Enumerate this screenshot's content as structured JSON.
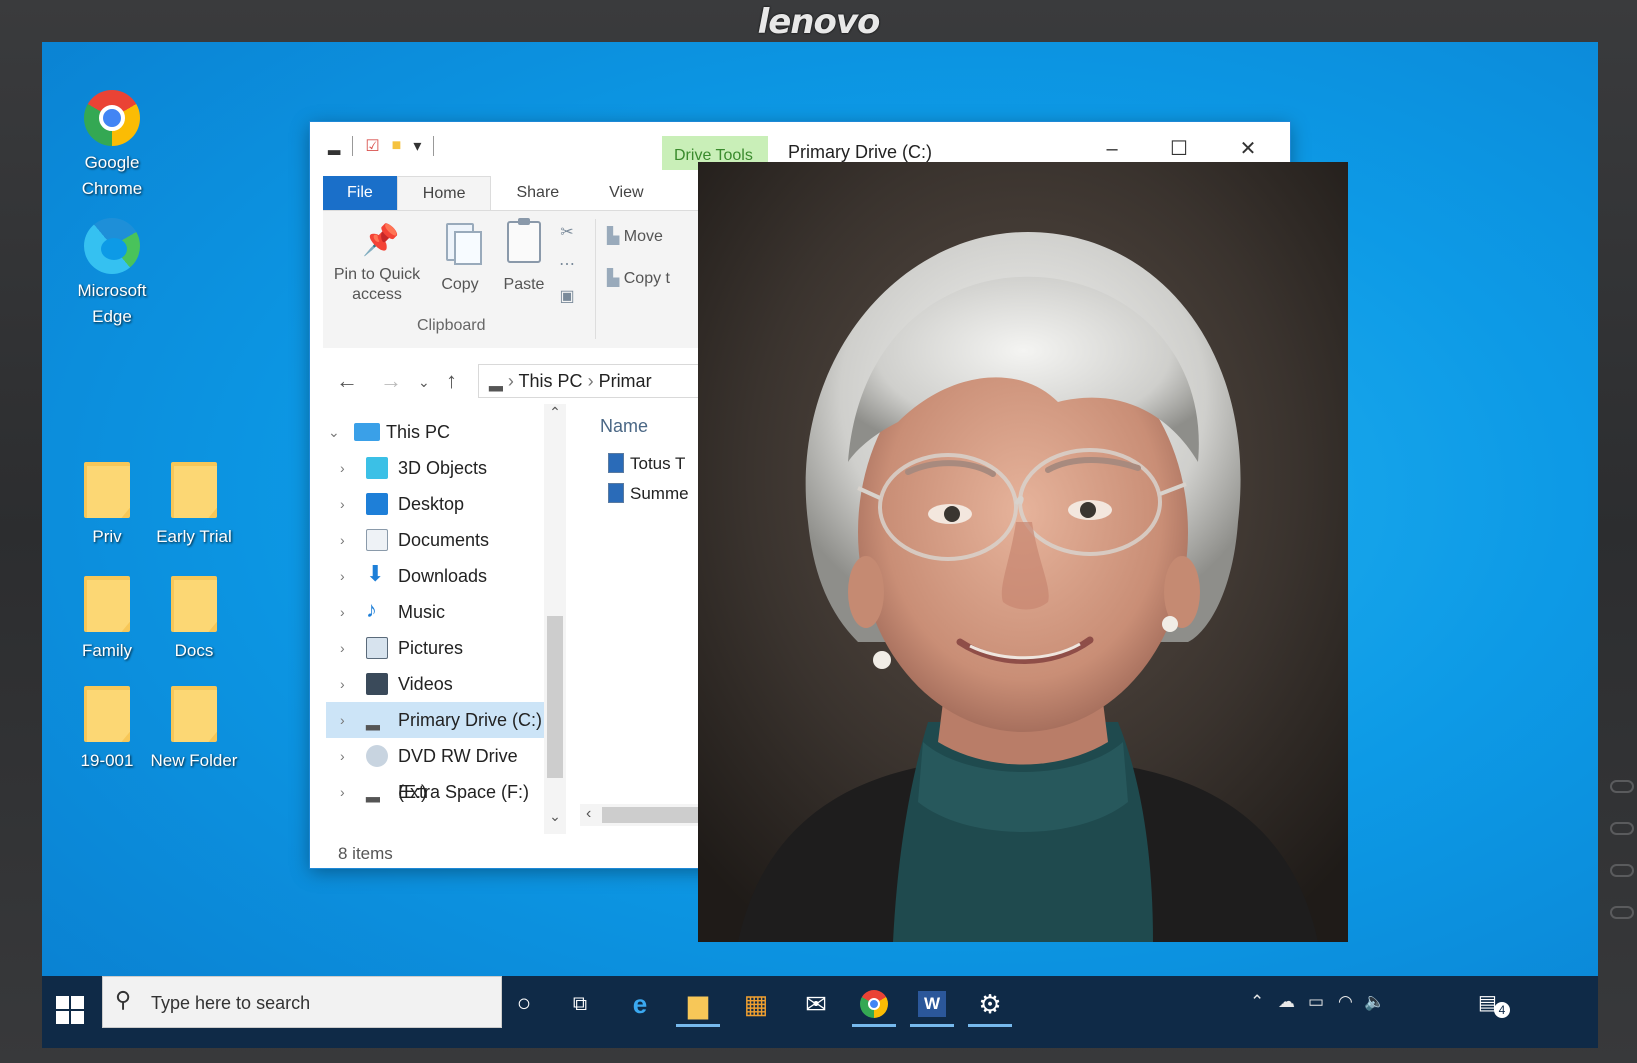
{
  "monitor": {
    "brand": "lenovo"
  },
  "desktop": {
    "icons": [
      {
        "label": "Google Chrome",
        "icon": "chrome-icon"
      },
      {
        "label": "Microsoft Edge",
        "icon": "edge-icon"
      },
      {
        "label": "Priv",
        "icon": "folder-icon"
      },
      {
        "label": "Early Trial",
        "icon": "folder-icon"
      },
      {
        "label": "Family",
        "icon": "folder-icon"
      },
      {
        "label": "Docs",
        "icon": "folder-icon"
      },
      {
        "label": "19-001",
        "icon": "folder-icon"
      },
      {
        "label": "New Folder",
        "icon": "folder-icon"
      }
    ]
  },
  "explorer": {
    "context_tab": "Drive Tools",
    "title": "Primary Drive (C:)",
    "tabs": [
      "File",
      "Home",
      "Share",
      "View"
    ],
    "ribbon": {
      "pin_label": "Pin to Quick access",
      "copy_label": "Copy",
      "paste_label": "Paste",
      "group_label": "Clipboard",
      "move_label": "Move",
      "copy_to_label": "Copy t"
    },
    "address": {
      "crumbs": [
        "This PC",
        "Primar"
      ]
    },
    "tree": [
      {
        "label": "This PC",
        "icon": "computer-icon"
      },
      {
        "label": "3D Objects",
        "icon": "cube-icon"
      },
      {
        "label": "Desktop",
        "icon": "desktop-icon"
      },
      {
        "label": "Documents",
        "icon": "document-icon"
      },
      {
        "label": "Downloads",
        "icon": "download-icon"
      },
      {
        "label": "Music",
        "icon": "music-icon"
      },
      {
        "label": "Pictures",
        "icon": "pictures-icon"
      },
      {
        "label": "Videos",
        "icon": "video-icon"
      },
      {
        "label": "Primary Drive (C:)",
        "icon": "drive-icon"
      },
      {
        "label": "DVD RW Drive (E:)",
        "icon": "dvd-icon"
      },
      {
        "label": "Extra Space (F:)",
        "icon": "drive-icon"
      }
    ],
    "file_header": "Name",
    "files": [
      "Totus T",
      "Summe"
    ],
    "status": "8 items"
  },
  "taskbar": {
    "search_placeholder": "Type here to search",
    "apps": [
      "cortana-icon",
      "task-view-icon",
      "edge-icon",
      "file-explorer-icon",
      "store-icon",
      "mail-icon",
      "chrome-icon",
      "word-icon",
      "settings-icon"
    ],
    "notification_count": "4"
  },
  "colors": {
    "accent": "#1a6fc9",
    "desktop": "#0d9ae6",
    "taskbar": "#0f2a47",
    "context_tab": "#c9efb8"
  }
}
